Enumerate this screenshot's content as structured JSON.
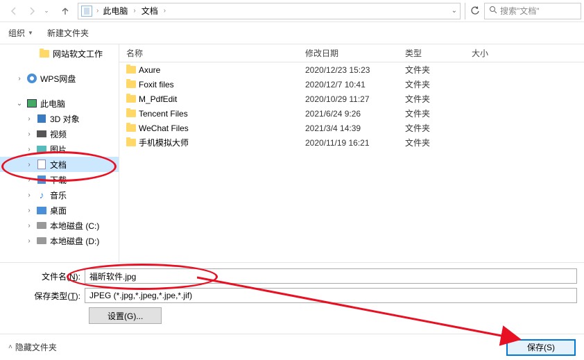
{
  "nav": {
    "breadcrumb": [
      "此电脑",
      "文档"
    ],
    "search_placeholder": "搜索\"文档\""
  },
  "toolbar": {
    "organize": "组织",
    "new_folder": "新建文件夹"
  },
  "sidebar": {
    "items": [
      {
        "label": "网站软文工作",
        "icon": "folder",
        "indent": 28,
        "expand": ""
      },
      {
        "label": "WPS网盘",
        "icon": "wps",
        "indent": 10,
        "expand": "›"
      },
      {
        "label": "此电脑",
        "icon": "pc",
        "indent": 10,
        "expand": "⌄"
      },
      {
        "label": "3D 对象",
        "icon": "obj3d",
        "indent": 24,
        "expand": "›"
      },
      {
        "label": "视频",
        "icon": "video",
        "indent": 24,
        "expand": "›"
      },
      {
        "label": "图片",
        "icon": "pic",
        "indent": 24,
        "expand": "›"
      },
      {
        "label": "文档",
        "icon": "doc",
        "indent": 24,
        "expand": "›",
        "selected": true
      },
      {
        "label": "下载",
        "icon": "download",
        "indent": 24,
        "expand": "›"
      },
      {
        "label": "音乐",
        "icon": "music",
        "indent": 24,
        "expand": "›"
      },
      {
        "label": "桌面",
        "icon": "desktop",
        "indent": 24,
        "expand": "›"
      },
      {
        "label": "本地磁盘 (C:)",
        "icon": "disk",
        "indent": 24,
        "expand": "›"
      },
      {
        "label": "本地磁盘 (D:)",
        "icon": "disk",
        "indent": 24,
        "expand": "›"
      }
    ]
  },
  "columns": {
    "name": "名称",
    "date": "修改日期",
    "type": "类型",
    "size": "大小"
  },
  "files": [
    {
      "name": "Axure",
      "date": "2020/12/23 15:23",
      "type": "文件夹"
    },
    {
      "name": "Foxit files",
      "date": "2020/12/7 10:41",
      "type": "文件夹"
    },
    {
      "name": "M_PdfEdit",
      "date": "2020/10/29 11:27",
      "type": "文件夹"
    },
    {
      "name": "Tencent Files",
      "date": "2021/6/24 9:26",
      "type": "文件夹"
    },
    {
      "name": "WeChat Files",
      "date": "2021/3/4 14:39",
      "type": "文件夹"
    },
    {
      "name": "手机模拟大师",
      "date": "2020/11/19 16:21",
      "type": "文件夹"
    }
  ],
  "form": {
    "filename_label_pre": "文件名(",
    "filename_label_u": "N",
    "filename_label_post": "):",
    "filename_value": "福昕软件.jpg",
    "filetype_label_pre": "保存类型(",
    "filetype_label_u": "T",
    "filetype_label_post": "):",
    "filetype_value": "JPEG (*.jpg,*.jpeg,*.jpe,*.jif)",
    "settings_label": "设置(G)..."
  },
  "footer": {
    "hide_folders": "隐藏文件夹",
    "save": "保存(S)"
  }
}
